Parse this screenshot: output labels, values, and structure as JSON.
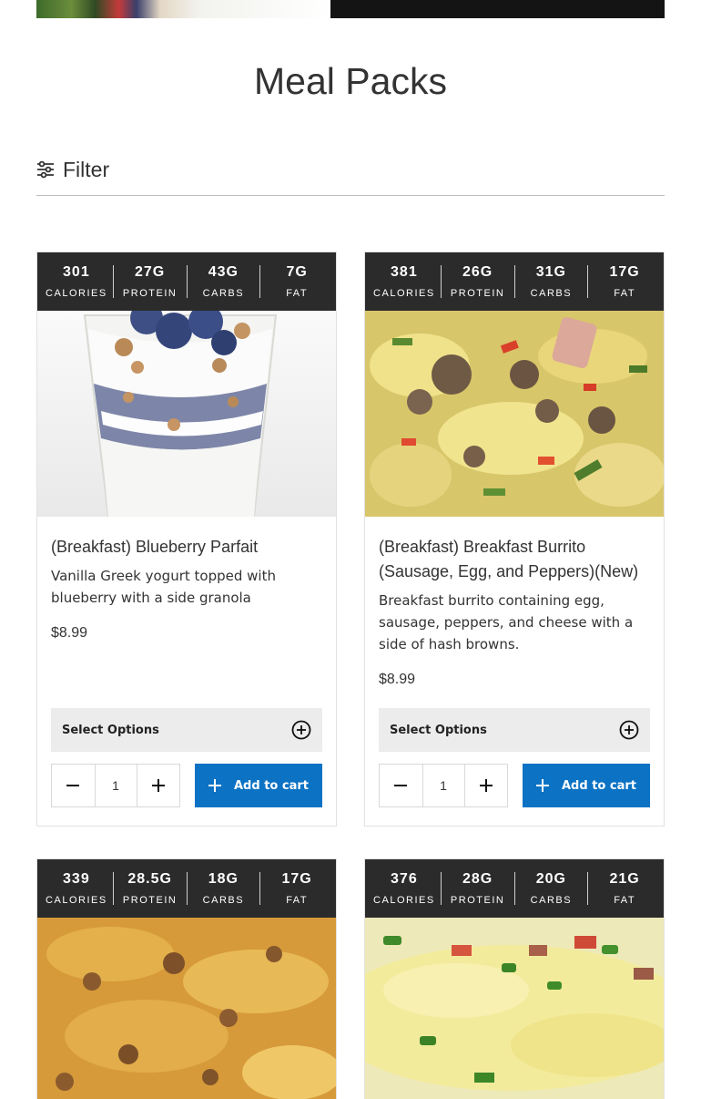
{
  "page": {
    "title": "Meal Packs",
    "filter_label": "Filter"
  },
  "colors": {
    "macro_bar": "#2b2b2b",
    "add_button": "#0b72c4",
    "select_bg": "#ececec"
  },
  "products": [
    {
      "macros": [
        {
          "value": "301",
          "label": "CALORIES"
        },
        {
          "value": "27G",
          "label": "PROTEIN"
        },
        {
          "value": "43G",
          "label": "CARBS"
        },
        {
          "value": "7G",
          "label": "FAT"
        }
      ],
      "image": "blueberry-parfait-photo",
      "title": "(Breakfast) Blueberry Parfait",
      "description": "Vanilla Greek yogurt topped with blueberry with a side granola",
      "price": "$8.99",
      "select_label": "Select Options",
      "quantity": "1",
      "add_label": "Add to cart"
    },
    {
      "macros": [
        {
          "value": "381",
          "label": "CALORIES"
        },
        {
          "value": "26G",
          "label": "PROTEIN"
        },
        {
          "value": "31G",
          "label": "CARBS"
        },
        {
          "value": "17G",
          "label": "FAT"
        }
      ],
      "image": "breakfast-burrito-filling-photo",
      "title": "(Breakfast) Breakfast Burrito (Sausage, Egg, and Peppers)(New)",
      "description": "Breakfast burrito containing egg, sausage, peppers, and cheese with a side of hash browns.",
      "price": "$8.99",
      "select_label": "Select Options",
      "quantity": "1",
      "add_label": "Add to cart"
    },
    {
      "macros": [
        {
          "value": "339",
          "label": "CALORIES"
        },
        {
          "value": "28.5G",
          "label": "PROTEIN"
        },
        {
          "value": "18G",
          "label": "CARBS"
        },
        {
          "value": "17G",
          "label": "FAT"
        }
      ],
      "image": "egg-casserole-photo"
    },
    {
      "macros": [
        {
          "value": "376",
          "label": "CALORIES"
        },
        {
          "value": "28G",
          "label": "PROTEIN"
        },
        {
          "value": "20G",
          "label": "CARBS"
        },
        {
          "value": "21G",
          "label": "FAT"
        }
      ],
      "image": "omelette-photo"
    }
  ]
}
